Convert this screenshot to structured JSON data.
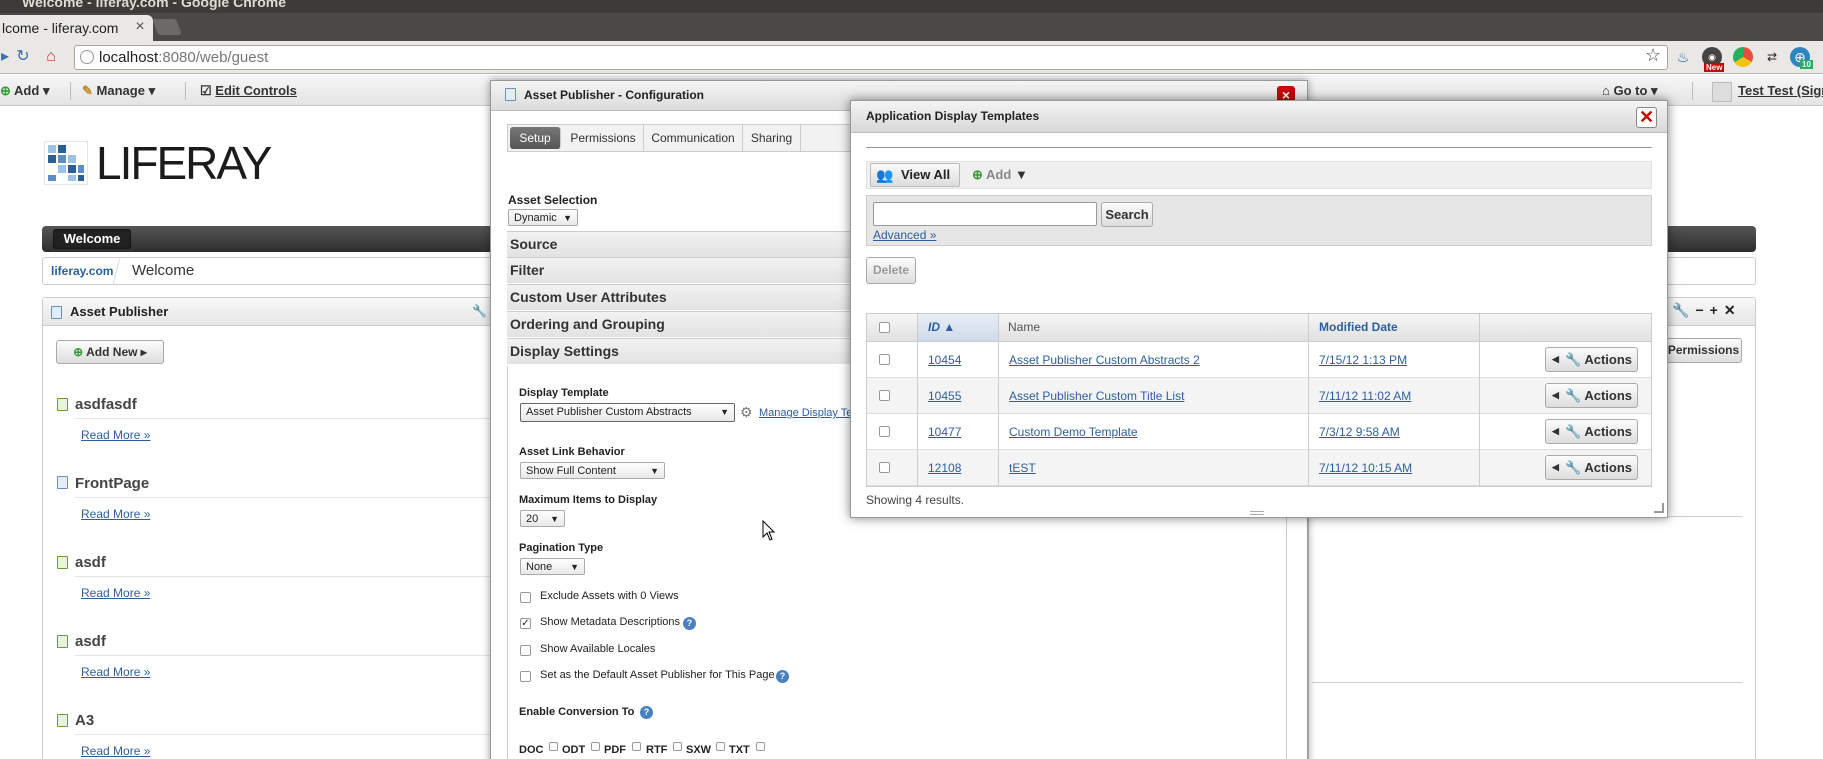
{
  "browser": {
    "window_title": "Welcome - liferay.com - Google Chrome",
    "tab_title": "lcome - liferay.com",
    "url_host": "localhost",
    "url_rest": ":8080/web/guest",
    "ext_badge_1": "New",
    "ext_badge_2": "10"
  },
  "dockbar": {
    "add": "Add",
    "manage": "Manage",
    "edit_controls": "Edit Controls",
    "goto": "Go to",
    "user": "Test Test (Sign"
  },
  "page": {
    "logo_text": "LIFERAY",
    "nav_welcome": "Welcome",
    "breadcrumb_site": "liferay.com",
    "breadcrumb_page": "Welcome",
    "portlet_title": "Asset Publisher",
    "add_new": "Add New",
    "entries": [
      {
        "title": "asdfasdf",
        "more": "Read More »"
      },
      {
        "title": "FrontPage",
        "more": "Read More »"
      },
      {
        "title": "asdf",
        "more": "Read More »"
      },
      {
        "title": "asdf",
        "more": "Read More »"
      },
      {
        "title": "A3",
        "more": "Read More »"
      }
    ],
    "right_permissions": "Permissions"
  },
  "config": {
    "title": "Asset Publisher - Configuration",
    "tabs": [
      "Setup",
      "Permissions",
      "Communication",
      "Sharing"
    ],
    "asset_selection_label": "Asset Selection",
    "asset_selection_value": "Dynamic",
    "sections": [
      "Source",
      "Filter",
      "Custom User Attributes",
      "Ordering and Grouping",
      "Display Settings"
    ],
    "display_template_label": "Display Template",
    "display_template_value": "Asset Publisher Custom Abstracts",
    "manage_link": "Manage Display Te",
    "asset_link_label": "Asset Link Behavior",
    "asset_link_value": "Show Full Content",
    "max_items_label": "Maximum Items to Display",
    "max_items_value": "20",
    "pagination_label": "Pagination Type",
    "pagination_value": "None",
    "checks": [
      {
        "label": "Exclude Assets with 0 Views",
        "checked": false
      },
      {
        "label": "Show Metadata Descriptions",
        "checked": true
      },
      {
        "label": "Show Available Locales",
        "checked": false
      },
      {
        "label": "Set as the Default Asset Publisher for This Page",
        "checked": false
      }
    ],
    "conversion_label": "Enable Conversion To",
    "formats": [
      "DOC",
      "ODT",
      "PDF",
      "RTF",
      "SXW",
      "TXT"
    ]
  },
  "adt": {
    "title": "Application Display Templates",
    "view_all": "View All",
    "add": "Add",
    "search_value": "",
    "search_button": "Search",
    "advanced": "Advanced »",
    "delete": "Delete",
    "columns": {
      "id": "ID ▲",
      "name": "Name",
      "modified": "Modified Date"
    },
    "rows": [
      {
        "id": "10454",
        "name": "Asset Publisher Custom Abstracts 2",
        "modified": "7/15/12 1:13 PM",
        "action": "Actions"
      },
      {
        "id": "10455",
        "name": "Asset Publisher Custom Title List",
        "modified": "7/11/12 11:02 AM",
        "action": "Actions"
      },
      {
        "id": "10477",
        "name": "Custom Demo Template",
        "modified": "7/3/12 9:58 AM",
        "action": "Actions"
      },
      {
        "id": "12108",
        "name": "tEST",
        "modified": "7/11/12 10:15 AM",
        "action": "Actions"
      }
    ],
    "showing": "Showing 4 results."
  }
}
